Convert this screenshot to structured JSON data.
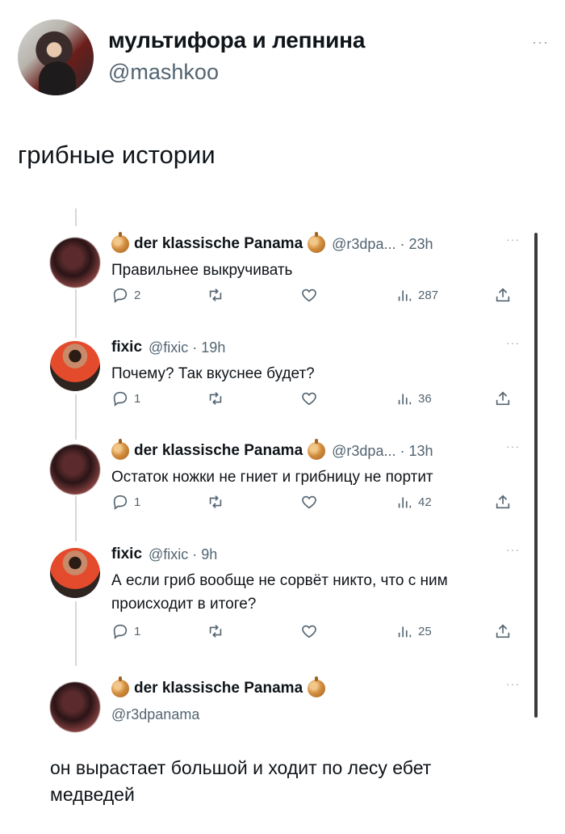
{
  "post": {
    "author_name": "мультифора и лепнина",
    "author_handle": "@mashkoo",
    "text": "грибные истории",
    "more_label": "···"
  },
  "replies": [
    {
      "name": "der klassische Panama",
      "meta": "@r3dpa... · 23h",
      "text": "Правильнее выкручивать",
      "replies": "2",
      "reposts": "",
      "likes": "",
      "views": "287",
      "more": "···"
    },
    {
      "name": "fixic",
      "meta": "@fixic · 19h",
      "text": "Почему? Так вкуснее будет?",
      "replies": "1",
      "reposts": "",
      "likes": "",
      "views": "36",
      "more": "···"
    },
    {
      "name": "der klassische Panama",
      "meta": "@r3dpa... · 13h",
      "text": "Остаток ножки не гниет и грибницу не портит",
      "replies": "1",
      "reposts": "",
      "likes": "",
      "views": "42",
      "more": "···"
    },
    {
      "name": "fixic",
      "meta": "@fixic · 9h",
      "text": "А если гриб вообще не сорвёт никто, что с ним происходит в итоге?",
      "replies": "1",
      "reposts": "",
      "likes": "",
      "views": "25",
      "more": "···"
    },
    {
      "name": "der klassische Panama",
      "meta": "@r3dpanama",
      "more": "···"
    }
  ],
  "final_text": "он вырастает большой и ходит по лесу ебет медведей",
  "icons": [
    "reply-icon",
    "repost-icon",
    "like-icon",
    "views-icon",
    "share-icon",
    "onion-emoji-icon"
  ]
}
